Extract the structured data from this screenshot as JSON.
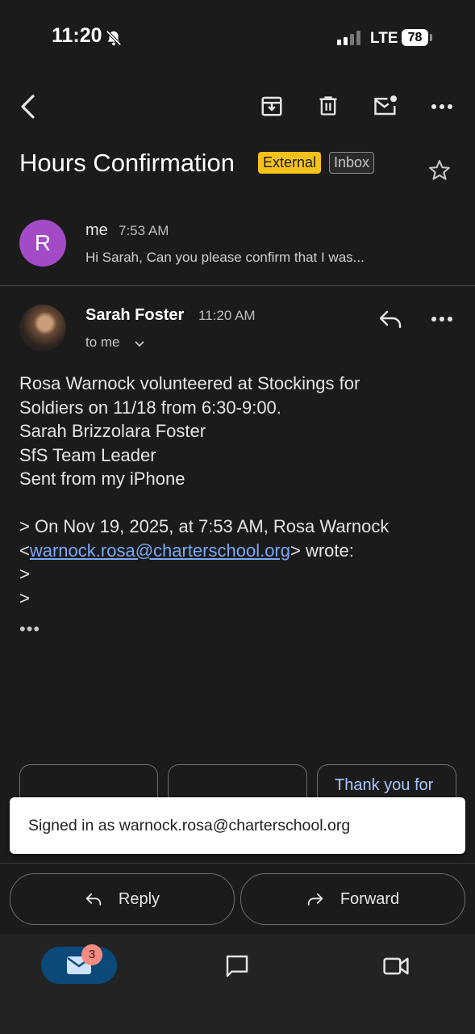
{
  "status_bar": {
    "time": "11:20",
    "network": "LTE",
    "battery": "78"
  },
  "toolbar": {
    "icons": [
      "back-arrow-icon",
      "archive-icon",
      "delete-icon",
      "mark-unread-icon",
      "more-icon"
    ]
  },
  "email": {
    "subject": "Hours Confirmation",
    "labels": {
      "external": "External",
      "inbox": "Inbox"
    },
    "external_color": "#f6c21a"
  },
  "collapsed_message": {
    "avatar_letter": "R",
    "avatar_color": "#a34bc7",
    "sender": "me",
    "time": "7:53 AM",
    "snippet": "Hi Sarah, Can you please confirm that I was..."
  },
  "open_message": {
    "sender": "Sarah Foster",
    "time": "11:20 AM",
    "recipient": "to me",
    "body": {
      "line1": "Rosa Warnock volunteered at Stockings for",
      "line2": "Soldiers on 11/18 from 6:30-9:00.",
      "line3": "Sarah Brizzolara Foster",
      "line4": "SfS Team Leader",
      "line5": "Sent from my iPhone",
      "quote_line1": "> On Nov 19, 2025, at 7:53 AM, Rosa Warnock",
      "quote_open": "<",
      "quote_email": "warnock.rosa@charterschool.org",
      "quote_close": "> wrote:",
      "quote_line3": ">",
      "quote_line4": ">"
    },
    "trimmed_content": "•••"
  },
  "smart_replies": [
    "",
    "",
    "Thank you for"
  ],
  "toast": {
    "text": "Signed in as warnock.rosa@charterschool.org"
  },
  "actions": {
    "reply": "Reply",
    "forward": "Forward"
  },
  "bottom_nav": {
    "mail_badge": "3",
    "accent": "#0b4a78"
  }
}
